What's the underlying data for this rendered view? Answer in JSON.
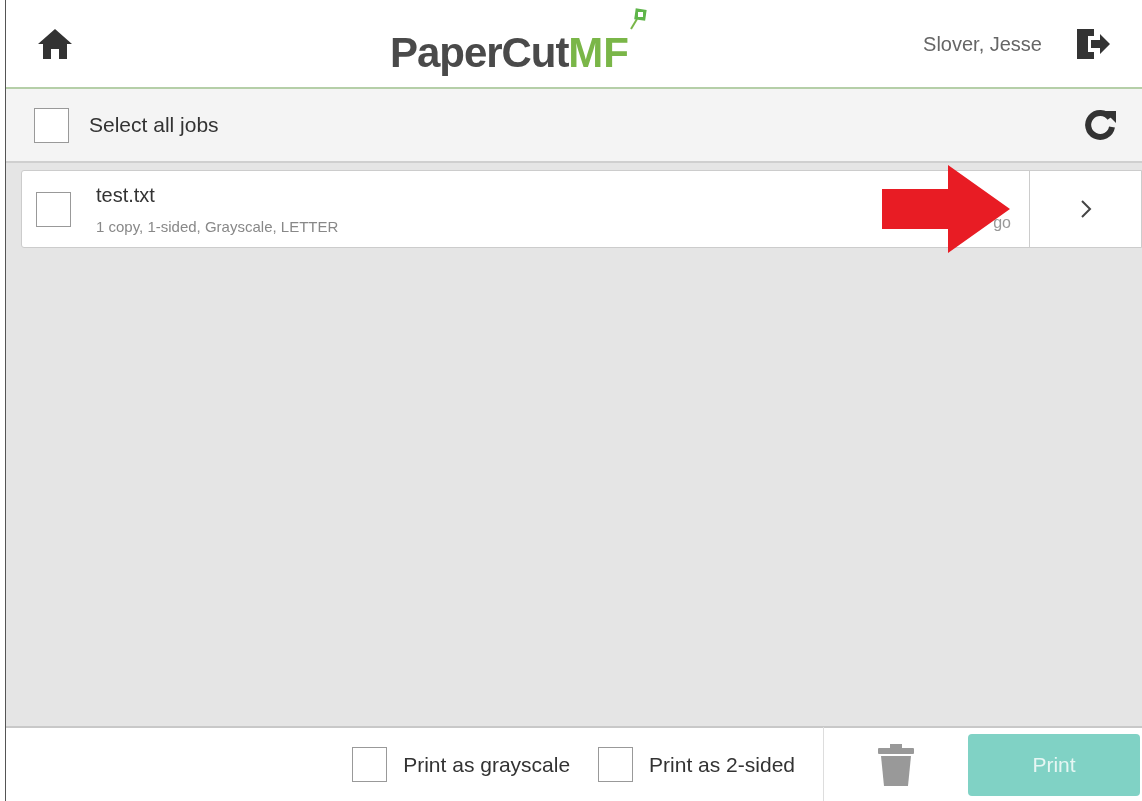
{
  "header": {
    "logo": {
      "main": "PaperCut",
      "suffix": "MF"
    },
    "user": "Slover, Jesse"
  },
  "select_all": {
    "label": "Select all jobs",
    "checked": false
  },
  "jobs": [
    {
      "name": "test.txt",
      "details": "1 copy, 1-sided, Grayscale, LETTER",
      "time": "go",
      "checked": false
    }
  ],
  "options": [
    {
      "label": "Print as grayscale",
      "checked": false
    },
    {
      "label": "Print as 2-sided",
      "checked": false
    }
  ],
  "print_button": {
    "label": "Print",
    "disabled": true
  }
}
